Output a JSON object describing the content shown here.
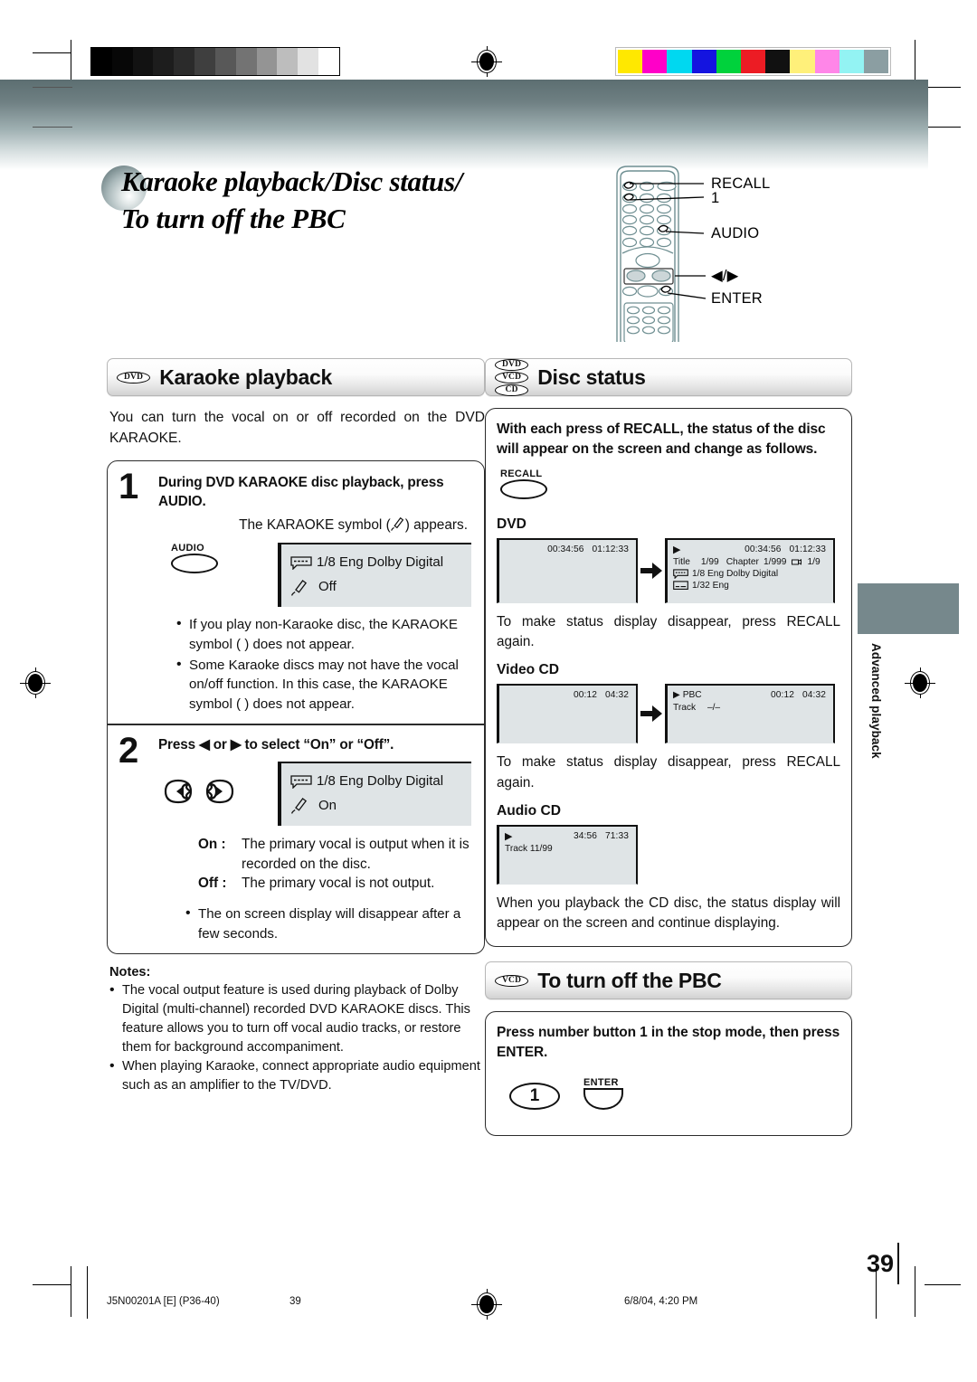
{
  "title": {
    "line1": "Karaoke playback/Disc status/",
    "line2": "To turn off the PBC"
  },
  "remote": {
    "callouts": [
      "RECALL",
      "1",
      "AUDIO",
      "◀/▶",
      "ENTER"
    ]
  },
  "karaoke": {
    "header": "Karaoke playback",
    "disc_chips": [
      "DVD"
    ],
    "intro": "You can turn the vocal on or off recorded on the DVD KARAOKE.",
    "step1": {
      "number": "1",
      "title": "During DVD KARAOKE disc playback, press AUDIO.",
      "sub": "The KARAOKE symbol (  ) appears.",
      "button_label": "AUDIO",
      "osd_line1": "1/8 Eng Dolby Digital",
      "osd_line2": "Off"
    },
    "bullets": [
      "If you play non-Karaoke disc, the KARAOKE symbol (  ) does not appear.",
      "Some Karaoke discs may not have the vocal on/off function. In this case, the KARAOKE symbol (  ) does not appear."
    ],
    "step2": {
      "number": "2",
      "title": "Press ◀ or ▶ to select “On” or “Off”.",
      "osd_line1": "1/8 Eng Dolby Digital",
      "osd_line2": "On"
    },
    "onoff": [
      {
        "term": "On :",
        "desc": "The primary vocal is output when it is recorded on the disc."
      },
      {
        "term": "Off :",
        "desc": "The primary vocal is not output."
      }
    ],
    "tail_bullet": "The on screen display will disappear after a few seconds.",
    "notes_title": "Notes:",
    "notes": [
      "The vocal output feature is used during playback of Dolby Digital (multi-channel) recorded DVD KARAOKE discs. This feature allows you to turn off vocal audio tracks, or restore them for background accompaniment.",
      "When playing Karaoke, connect appropriate audio equipment such as an amplifier to the TV/DVD."
    ]
  },
  "disc_status": {
    "header": "Disc status",
    "disc_chips": [
      "DVD",
      "VCD",
      "CD"
    ],
    "lead": "With each press of RECALL, the status of the disc will appear on the screen and change as follows.",
    "button_label": "RECALL",
    "dvd": {
      "label": "DVD",
      "screen1": {
        "time_elapsed": "00:34:56",
        "time_total": "01:12:33"
      },
      "screen2": {
        "time_elapsed": "00:34:56",
        "time_total": "01:12:33",
        "row_title_label": "Title",
        "row_title_value": "1/99",
        "row_chapter_label": "Chapter",
        "row_chapter_value": "1/999",
        "row_angle_value": "1/9",
        "row_audio": "1/8   Eng Dolby Digital",
        "row_subtitle": "1/32  Eng"
      },
      "note": "To make status display disappear, press RECALL again."
    },
    "video_cd": {
      "label": "Video CD",
      "screen1": {
        "time_elapsed": "00:12",
        "time_total": "04:32"
      },
      "screen2": {
        "mode": "PBC",
        "time_elapsed": "00:12",
        "time_total": "04:32",
        "row_track_label": "Track",
        "row_track_value": "–/–"
      },
      "note": "To make status display disappear, press RECALL again."
    },
    "audio_cd": {
      "label": "Audio CD",
      "screen1": {
        "time_elapsed": "34:56",
        "time_total": "71:33",
        "row_track": "Track 11/99"
      },
      "note": "When you playback the CD disc, the status display will appear on the screen and continue displaying."
    }
  },
  "pbc": {
    "header": "To turn off the PBC",
    "disc_chips": [
      "VCD"
    ],
    "instruction": "Press number button 1 in the stop mode, then press ENTER.",
    "button_number": "1",
    "button_enter_label": "ENTER"
  },
  "side_tab": {
    "label": "Advanced playback"
  },
  "page_number": "39",
  "footer": {
    "doc_id": "J5N00201A [E] (P36-40)",
    "page": "39",
    "timestamp": "6/8/04, 4:20 PM"
  },
  "calibration": {
    "gray_steps": [
      "#000000",
      "#070707",
      "#121212",
      "#1d1d1d",
      "#2b2b2b",
      "#3f3f3f",
      "#585858",
      "#737373",
      "#949494",
      "#bdbdbd",
      "#e2e2e2",
      "#ffffff"
    ],
    "color_steps": [
      "#ffe800",
      "#ff00c8",
      "#00d8f0",
      "#1414e0",
      "#00d23c",
      "#ec1c24",
      "#111111",
      "#fff07a",
      "#ff86e8",
      "#93f3f3",
      "#8b9ea2"
    ]
  }
}
